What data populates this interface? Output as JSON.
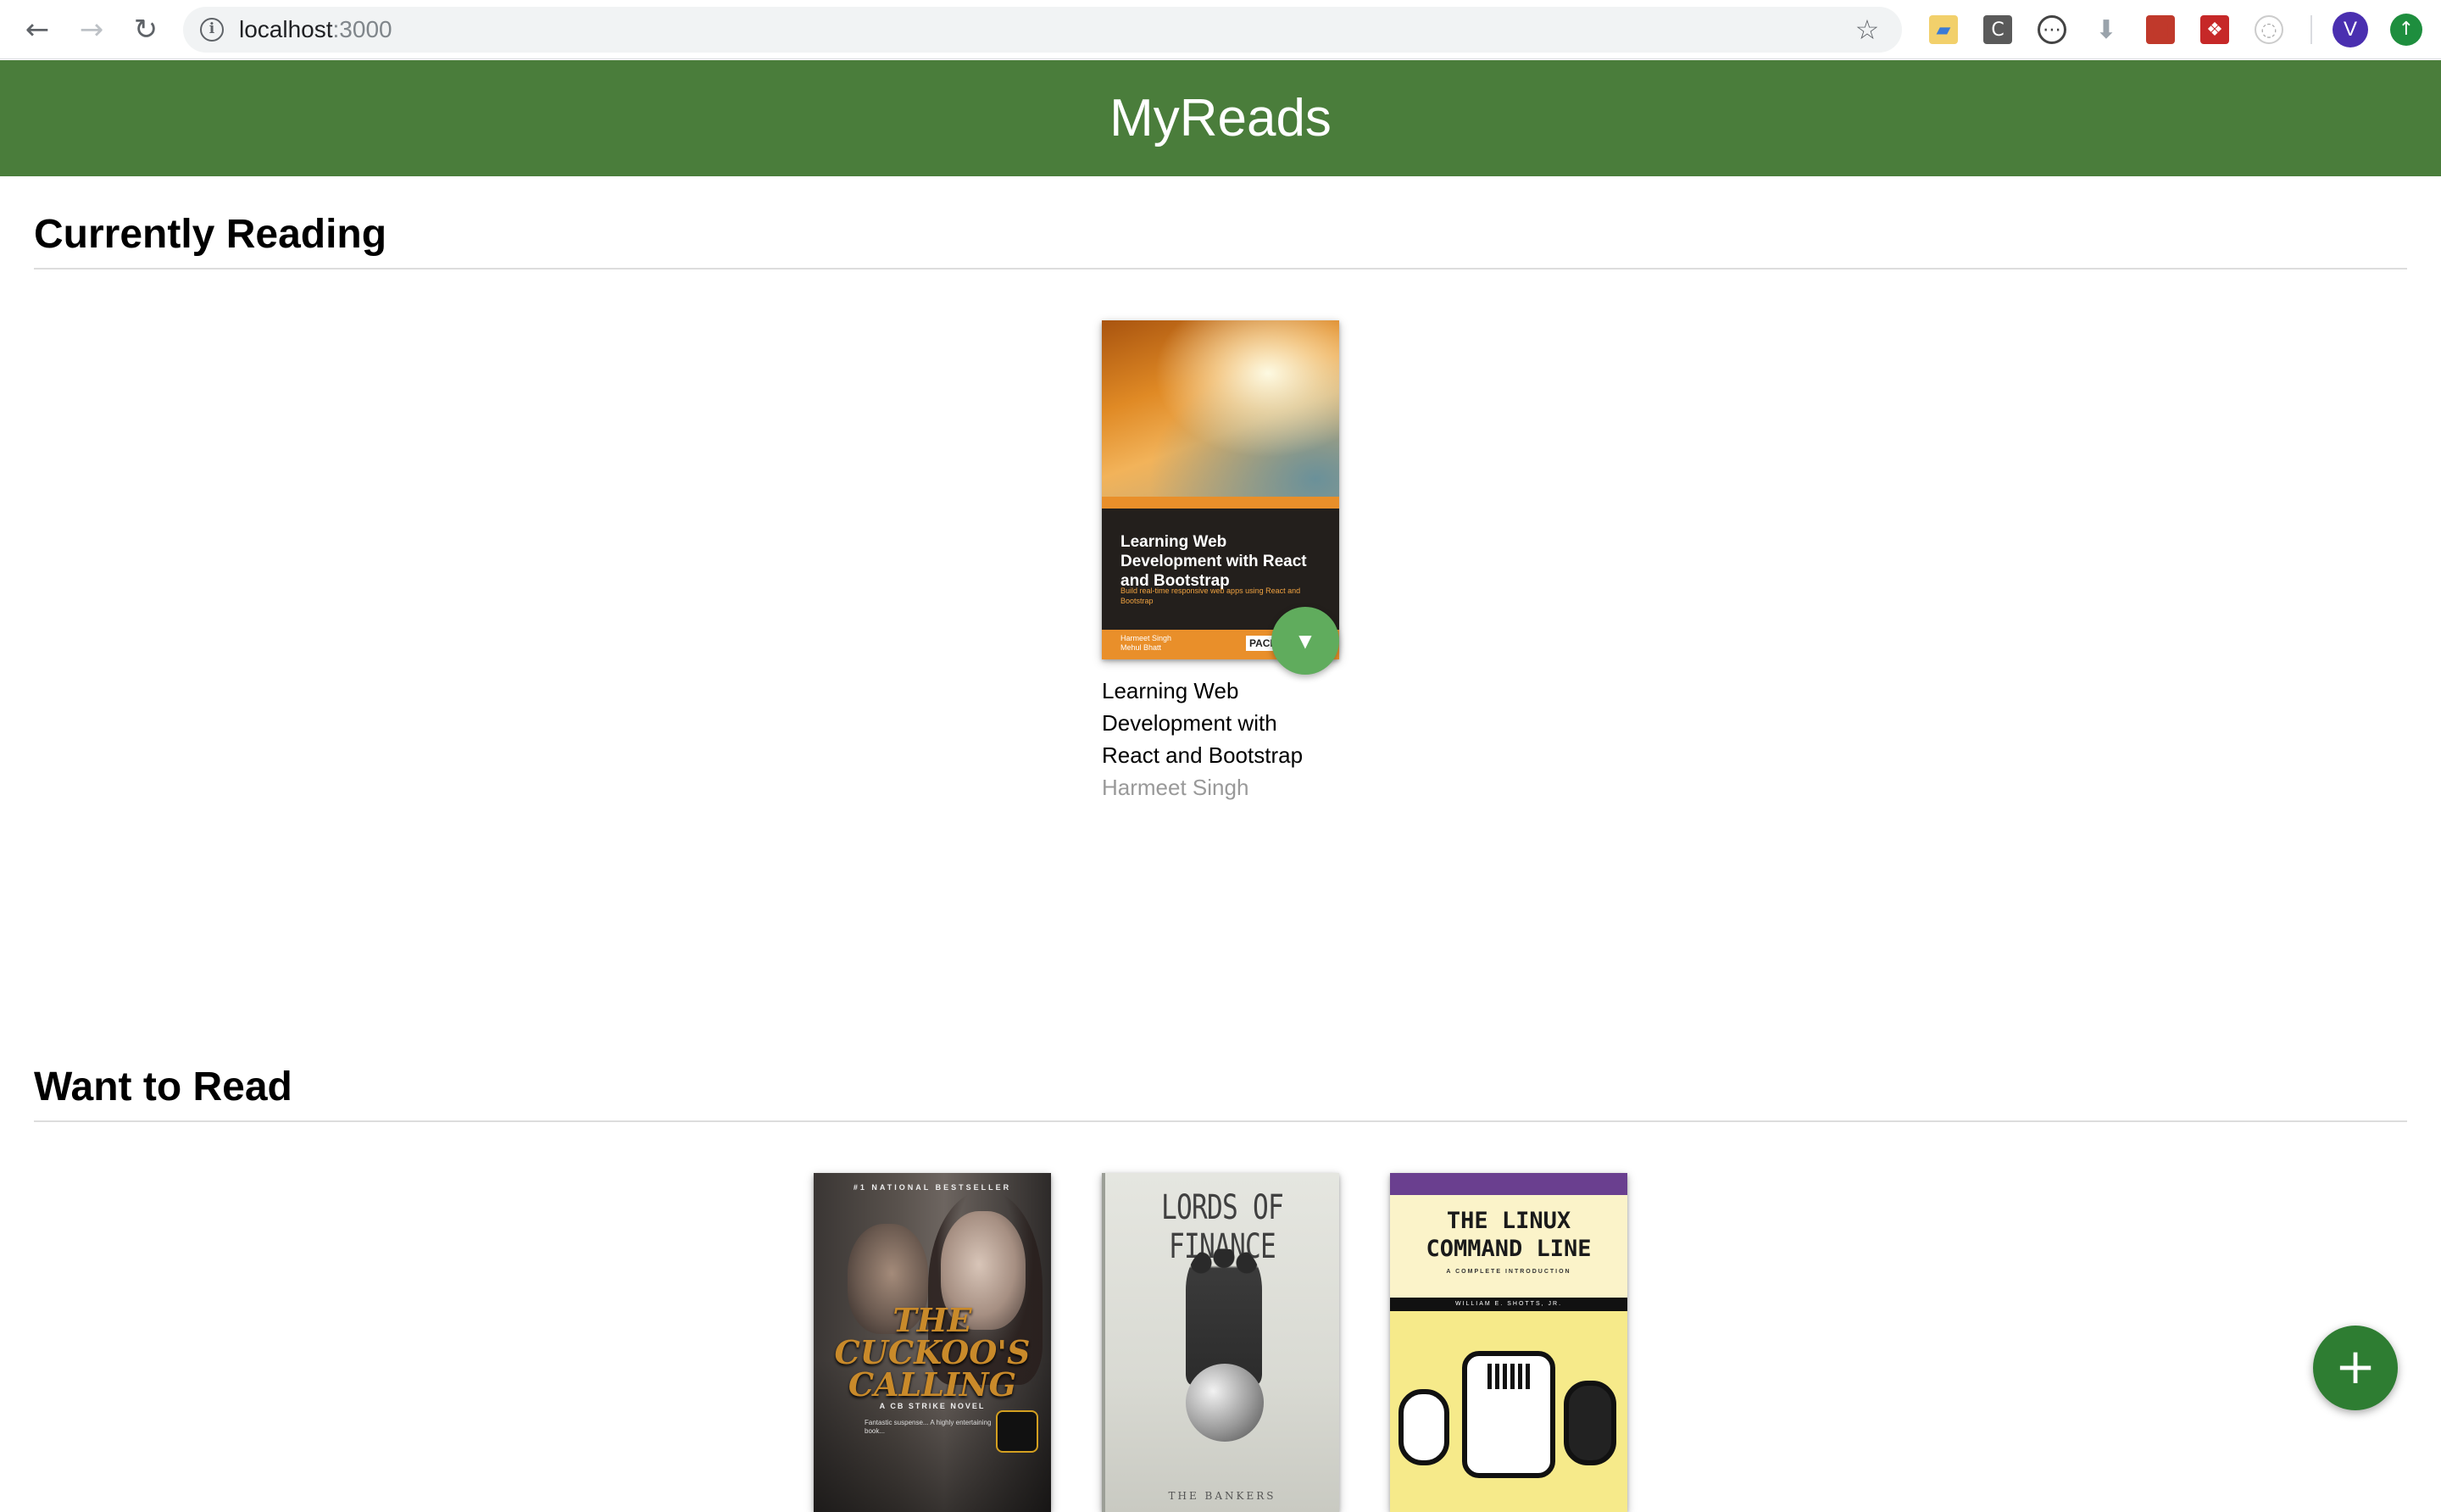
{
  "browser": {
    "back_icon": "←",
    "forward_icon": "→",
    "reload_icon": "↻",
    "info_icon": "i",
    "url_host": "localhost",
    "url_port": ":3000",
    "star_icon": "☆",
    "extensions": [
      {
        "name": "folders-extension-icon",
        "glyph": "▰",
        "color": "#e8b83a"
      },
      {
        "name": "c-extension-icon",
        "glyph": "C",
        "color": "#5a5a5a"
      },
      {
        "name": "code-extension-icon",
        "glyph": "⋯",
        "color": "#ffffff"
      },
      {
        "name": "download-extension-icon",
        "glyph": "⬇",
        "color": "#ffffff"
      },
      {
        "name": "red-book-extension-icon",
        "glyph": "■",
        "color": "#c0392b"
      },
      {
        "name": "red-grid-extension-icon",
        "glyph": "❖",
        "color": "#c62828"
      },
      {
        "name": "eye-extension-icon",
        "glyph": "◌",
        "color": "#ffffff"
      }
    ],
    "avatar_letter": "V",
    "update_icon": "↑"
  },
  "app": {
    "title": "MyReads",
    "header_color": "#4a7d3b"
  },
  "shelves": [
    {
      "title": "Currently Reading",
      "books": [
        {
          "title": "Learning Web Development with React and Bootstrap",
          "authors": "Harmeet Singh",
          "cover": {
            "title": "Learning Web Development with React and Bootstrap",
            "subtitle": "Build real-time responsive web apps using React and Bootstrap",
            "authors_line1": "Harmeet Singh",
            "authors_line2": "Mehul Bhatt",
            "publisher": "PACKT"
          }
        }
      ]
    },
    {
      "title": "Want to Read",
      "books": [
        {
          "cover": {
            "top": "#1 NATIONAL BESTSELLER",
            "title": "THE CUCKOO'S CALLING",
            "subtitle": "A CB STRIKE NOVEL",
            "quote": "Fantastic suspense... A highly entertaining book..."
          }
        },
        {
          "cover": {
            "title": "LORDS OF FINANCE",
            "bottom": "THE BANKERS"
          }
        },
        {
          "cover": {
            "title_line1": "THE LINUX",
            "title_line2": "COMMAND LINE",
            "subtitle": "A COMPLETE INTRODUCTION",
            "author": "WILLIAM E. SHOTTS, JR."
          }
        }
      ]
    }
  ],
  "shelf_changer_icon": "▼",
  "open_search_icon": "+"
}
